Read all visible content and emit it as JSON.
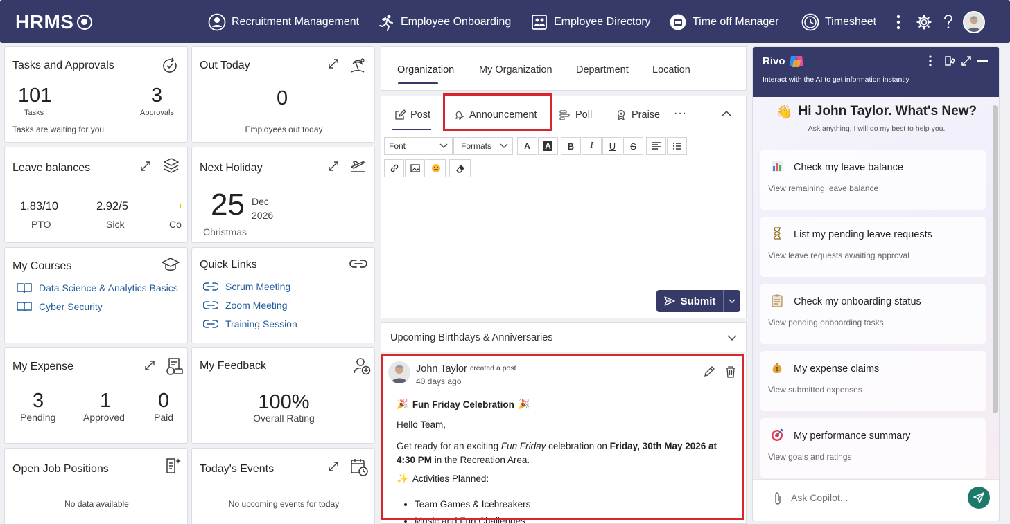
{
  "header": {
    "logo": "HRMS",
    "nav": [
      {
        "label": "Recruitment Management",
        "icon": "person-circle-icon"
      },
      {
        "label": "Employee Onboarding",
        "icon": "runner-icon"
      },
      {
        "label": "Employee Directory",
        "icon": "directory-icon"
      },
      {
        "label": "Time off Manager",
        "icon": "time-off-icon"
      },
      {
        "label": "Timesheet",
        "icon": "clock-icon"
      }
    ]
  },
  "tasks": {
    "title": "Tasks and Approvals",
    "tasks_count": "101",
    "tasks_label": "Tasks",
    "approvals_count": "3",
    "approvals_label": "Approvals",
    "footer": "Tasks are waiting for you"
  },
  "out_today": {
    "title": "Out Today",
    "count": "0",
    "label": "Employees out today"
  },
  "leave": {
    "title": "Leave balances",
    "items": [
      {
        "value": "1.83/10",
        "label": "PTO"
      },
      {
        "value": "2.92/5",
        "label": "Sick"
      },
      {
        "value": "",
        "label": "Co"
      }
    ]
  },
  "holiday": {
    "title": "Next Holiday",
    "day": "25",
    "month": "Dec",
    "year": "2026",
    "name": "Christmas"
  },
  "courses": {
    "title": "My Courses",
    "items": [
      "Data Science & Analytics Basics",
      "Cyber Security"
    ]
  },
  "quick_links": {
    "title": "Quick Links",
    "items": [
      "Scrum Meeting",
      "Zoom Meeting",
      "Training Session"
    ]
  },
  "expense": {
    "title": "My Expense",
    "items": [
      {
        "value": "3",
        "label": "Pending"
      },
      {
        "value": "1",
        "label": "Approved"
      },
      {
        "value": "0",
        "label": "Paid"
      }
    ]
  },
  "feedback": {
    "title": "My Feedback",
    "value": "100%",
    "label": "Overall Rating"
  },
  "jobs": {
    "title": "Open Job Positions",
    "empty": "No data available"
  },
  "events": {
    "title": "Today's Events",
    "empty": "No upcoming events for today"
  },
  "org_tabs": [
    "Organization",
    "My Organization",
    "Department",
    "Location"
  ],
  "composer": {
    "tabs": [
      "Post",
      "Announcement",
      "Poll",
      "Praise"
    ],
    "font_label": "Font",
    "formats_label": "Formats",
    "submit_label": "Submit"
  },
  "birthdays": {
    "title": "Upcoming Birthdays & Anniversaries"
  },
  "post": {
    "author": "John Taylor",
    "action": "created a post",
    "time": "40 days ago",
    "title": "Fun Friday Celebration",
    "greeting": "Hello Team,",
    "body_pre": "Get ready for an exciting ",
    "body_em": "Fun Friday",
    "body_mid": " celebration on ",
    "body_strong": "Friday, 30th May 2026 at 4:30 PM",
    "body_post": " in the Recreation Area.",
    "activities_heading": "Activities Planned:",
    "activities": [
      "Team Games & Icebreakers",
      "Music and Fun Challenges"
    ]
  },
  "copilot": {
    "name": "Rivo",
    "subtitle": "Interact with the AI to get information instantly",
    "greeting": "Hi John Taylor. What's New?",
    "greeting_sub": "Ask anything, I will do my best to help you.",
    "suggestions": [
      {
        "title": "Check my leave balance",
        "sub": "View remaining leave balance",
        "icon": "bar-chart-icon"
      },
      {
        "title": "List my pending leave requests",
        "sub": "View leave requests awaiting approval",
        "icon": "hourglass-icon"
      },
      {
        "title": "Check my onboarding status",
        "sub": "View pending onboarding tasks",
        "icon": "clipboard-icon"
      },
      {
        "title": "My expense claims",
        "sub": "View submitted expenses",
        "icon": "money-bag-icon"
      },
      {
        "title": "My performance summary",
        "sub": "View goals and ratings",
        "icon": "target-icon"
      }
    ],
    "input_placeholder": "Ask Copilot..."
  },
  "colors": {
    "header": "#363a68",
    "highlight": "#d9262c",
    "link": "#1f5c9b"
  }
}
